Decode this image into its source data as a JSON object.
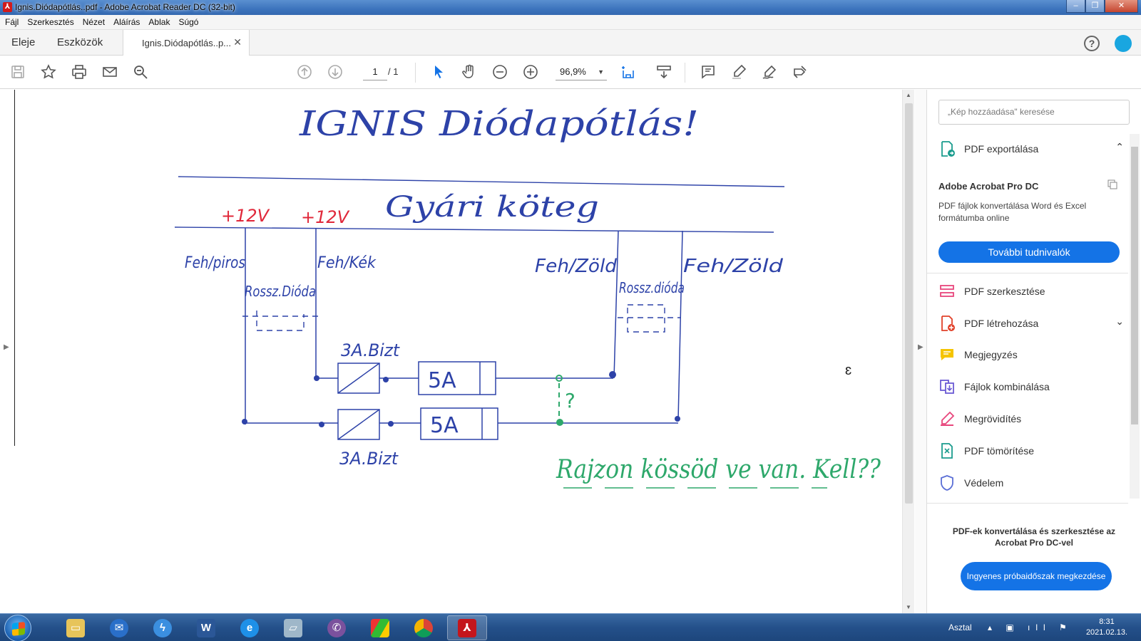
{
  "window": {
    "title": "Ignis.Diódapótlás..pdf - Adobe Acrobat Reader DC (32-bit)",
    "buttons": [
      "‒",
      "❐",
      "✕"
    ]
  },
  "menu": [
    "Fájl",
    "Szerkesztés",
    "Nézet",
    "Aláírás",
    "Ablak",
    "Súgó"
  ],
  "tabs": {
    "home": "Eleje",
    "tools": "Eszközök",
    "document": "Ignis.Diódapótlás..p...",
    "close": "✕"
  },
  "toolbar": {
    "page_current": "1",
    "page_total": "/ 1",
    "zoom": "96,9%"
  },
  "document": {
    "title": "IGNIS Diódapótlás!",
    "harness_label": "Gyári köteg",
    "voltage_left": "+12V",
    "voltage_right": "+12V",
    "wire_1": "Feh/piros",
    "wire_2": "Feh/Kék",
    "wire_3": "Feh/Zöld",
    "wire_4": "Feh/Zöld",
    "diode_left": "Rossz.Dióda",
    "diode_right": "Rossz.dióda",
    "fuse_top_label": "3A.Bizt",
    "fuse_bottom_label": "3A.Bizt",
    "fuse_top_value": "5A",
    "fuse_bottom_value": "5A",
    "question": "?",
    "note": "Rajzon kössöd ve van. Kell??"
  },
  "right_pane": {
    "search_placeholder": "„Kép hozzáadása\" keresése",
    "export_label": "PDF exportálása",
    "product_title": "Adobe Acrobat Pro DC",
    "product_desc": "PDF fájlok konvertálása Word és Excel formátumba online",
    "more_info": "További tudnivalók",
    "tools": [
      {
        "label": "PDF szerkesztése",
        "icon": "edit-pdf-icon",
        "color": "#e8467c"
      },
      {
        "label": "PDF létrehozása",
        "icon": "create-pdf-icon",
        "color": "#e1412a"
      },
      {
        "label": "Megjegyzés",
        "icon": "comment-icon",
        "color": "#f5c400"
      },
      {
        "label": "Fájlok kombinálása",
        "icon": "combine-icon",
        "color": "#6b5bd4"
      },
      {
        "label": "Megrövidítés",
        "icon": "redact-icon",
        "color": "#e8467c"
      },
      {
        "label": "PDF tömörítése",
        "icon": "compress-icon",
        "color": "#1b9c8e"
      },
      {
        "label": "Védelem",
        "icon": "protect-icon",
        "color": "#5b6fd6"
      }
    ],
    "promo_text": "PDF-ek konvertálása és szerkesztése az Acrobat Pro DC-vel",
    "promo_button": "Ingyenes próbaidőszak megkezdése"
  },
  "taskbar": {
    "desktop": "Asztal",
    "time": "8:31",
    "date": "2021.02.13."
  }
}
